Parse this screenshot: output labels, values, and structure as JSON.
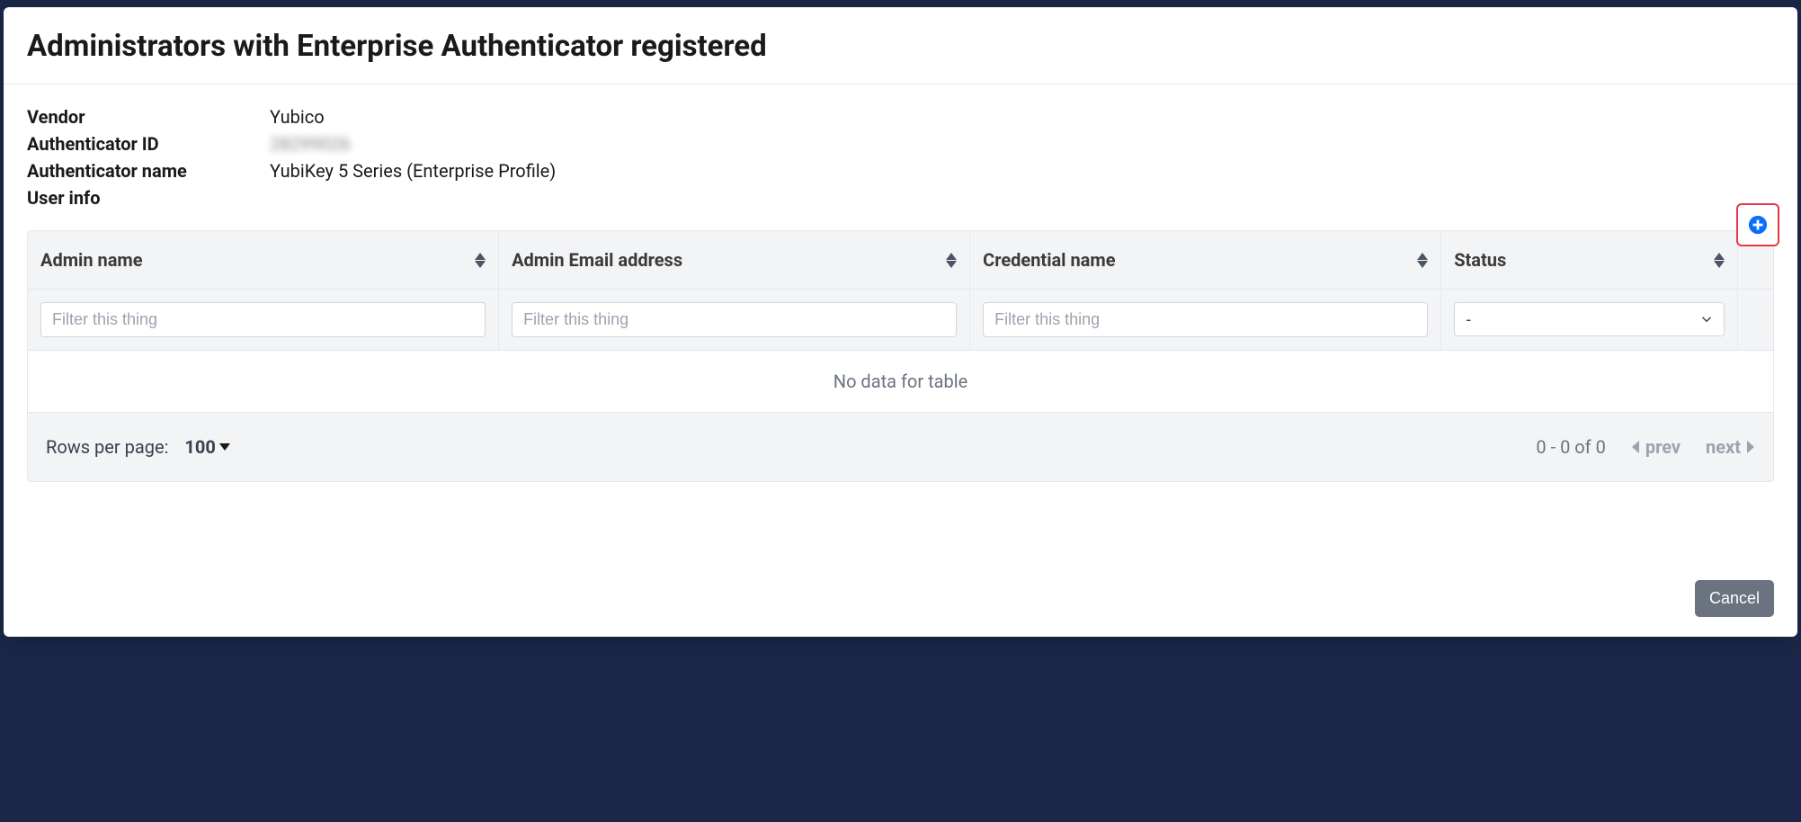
{
  "modal": {
    "title": "Administrators with Enterprise Authenticator registered",
    "info": {
      "vendor_label": "Vendor",
      "vendor_value": "Yubico",
      "auth_id_label": "Authenticator ID",
      "auth_id_value": "28299026",
      "auth_name_label": "Authenticator name",
      "auth_name_value": "YubiKey 5 Series (Enterprise Profile)",
      "user_info_label": "User info"
    },
    "table": {
      "columns": {
        "admin_name": "Admin name",
        "admin_email": "Admin Email address",
        "credential_name": "Credential name",
        "status": "Status"
      },
      "filter_placeholder": "Filter this thing",
      "status_filter_value": "-",
      "no_data": "No data for table"
    },
    "pagination": {
      "rows_label": "Rows per page:",
      "rows_value": "100",
      "range": "0 - 0 of 0",
      "prev": "prev",
      "next": "next"
    },
    "footer": {
      "cancel": "Cancel"
    }
  }
}
